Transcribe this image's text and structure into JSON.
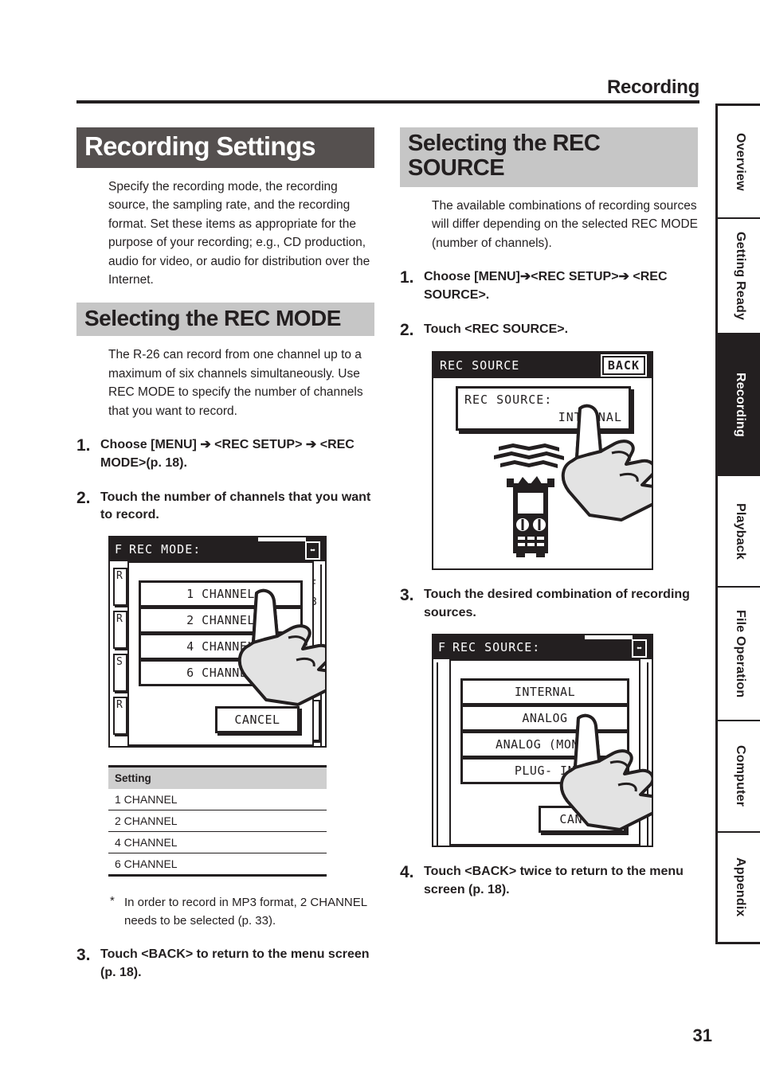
{
  "header": {
    "running_head": "Recording"
  },
  "folio": {
    "page_number": "31"
  },
  "left_column": {
    "section_title": "Recording Settings",
    "intro": "Specify the recording mode, the recording source, the sampling rate, and the recording format. Set these items as appropriate for the purpose of your recording; e.g., CD production, audio for video, or audio for distribution over the Internet.",
    "subsection_title": "Selecting the REC MODE",
    "subsection_intro": "The R-26 can record from one channel up to a maximum of six channels simultaneously. Use REC MODE to specify the number of channels that you want to record.",
    "steps": [
      {
        "num": "1.",
        "text": "Choose [MENU] ➔ <REC SETUP> ➔ <REC MODE>(p. 18)."
      },
      {
        "num": "2.",
        "text": "Touch the number of channels that you want to record."
      },
      {
        "num": "3.",
        "text": "Touch <BACK> to return to the menu screen (p. 18)."
      }
    ],
    "lcd_rec_mode": {
      "bg_title_fragment": "F",
      "title": "REC MODE:",
      "corner_glyph": "⬌",
      "bg_left_items": [
        "R",
        "R",
        "S",
        "R"
      ],
      "bg_right_fragments": [
        "F",
        "3"
      ],
      "options": [
        "1 CHANNEL",
        "2 CHANNEL",
        "4 CHANNEL",
        "6 CHANNEL"
      ],
      "cancel_label": "CANCEL",
      "touched_option": "1 CHANNEL"
    },
    "table": {
      "header": "Setting",
      "rows": [
        "1 CHANNEL",
        "2 CHANNEL",
        "4 CHANNEL",
        "6 CHANNEL"
      ]
    },
    "note": {
      "marker": "*",
      "text": "In order to record in MP3 format, 2 CHANNEL needs to be selected (p. 33)."
    }
  },
  "right_column": {
    "section_title": "Selecting the REC SOURCE",
    "intro": "The available combinations of recording sources will differ depending on the selected REC MODE (number of channels).",
    "steps": [
      {
        "num": "1.",
        "text": "Choose [MENU]➔<REC SETUP>➔ <REC SOURCE>."
      },
      {
        "num": "2.",
        "text": "Touch <REC SOURCE>."
      },
      {
        "num": "3.",
        "text": "Touch the desired combination of recording sources."
      },
      {
        "num": "4.",
        "text": "Touch <BACK> twice to return to the menu screen (p. 18)."
      }
    ],
    "lcd_rec_source_value": {
      "title": "REC SOURCE",
      "back_label": "BACK",
      "field_label": "REC SOURCE:",
      "field_value": "INTERNAL"
    },
    "lcd_rec_source_list": {
      "bg_title_fragment": "F",
      "title": "REC SOURCE:",
      "corner_glyph": "⬌",
      "options": [
        "INTERNAL",
        "ANALOG",
        "ANALOG (MONO)",
        "PLUG- IN"
      ],
      "cancel_label": "CANCEL",
      "touched_option": "ANALOG"
    }
  },
  "side_tabs": [
    {
      "label": "Overview",
      "active": false
    },
    {
      "label": "Getting Ready",
      "active": false
    },
    {
      "label": "Recording",
      "active": true
    },
    {
      "label": "Playback",
      "active": false
    },
    {
      "label": "File Operation",
      "active": false
    },
    {
      "label": "Computer",
      "active": false
    },
    {
      "label": "Appendix",
      "active": false
    }
  ],
  "colors": {
    "ink": "#231f20",
    "band_dark": "#55504f",
    "band_gray": "#c6c6c6",
    "table_header": "#cfcfcf"
  }
}
